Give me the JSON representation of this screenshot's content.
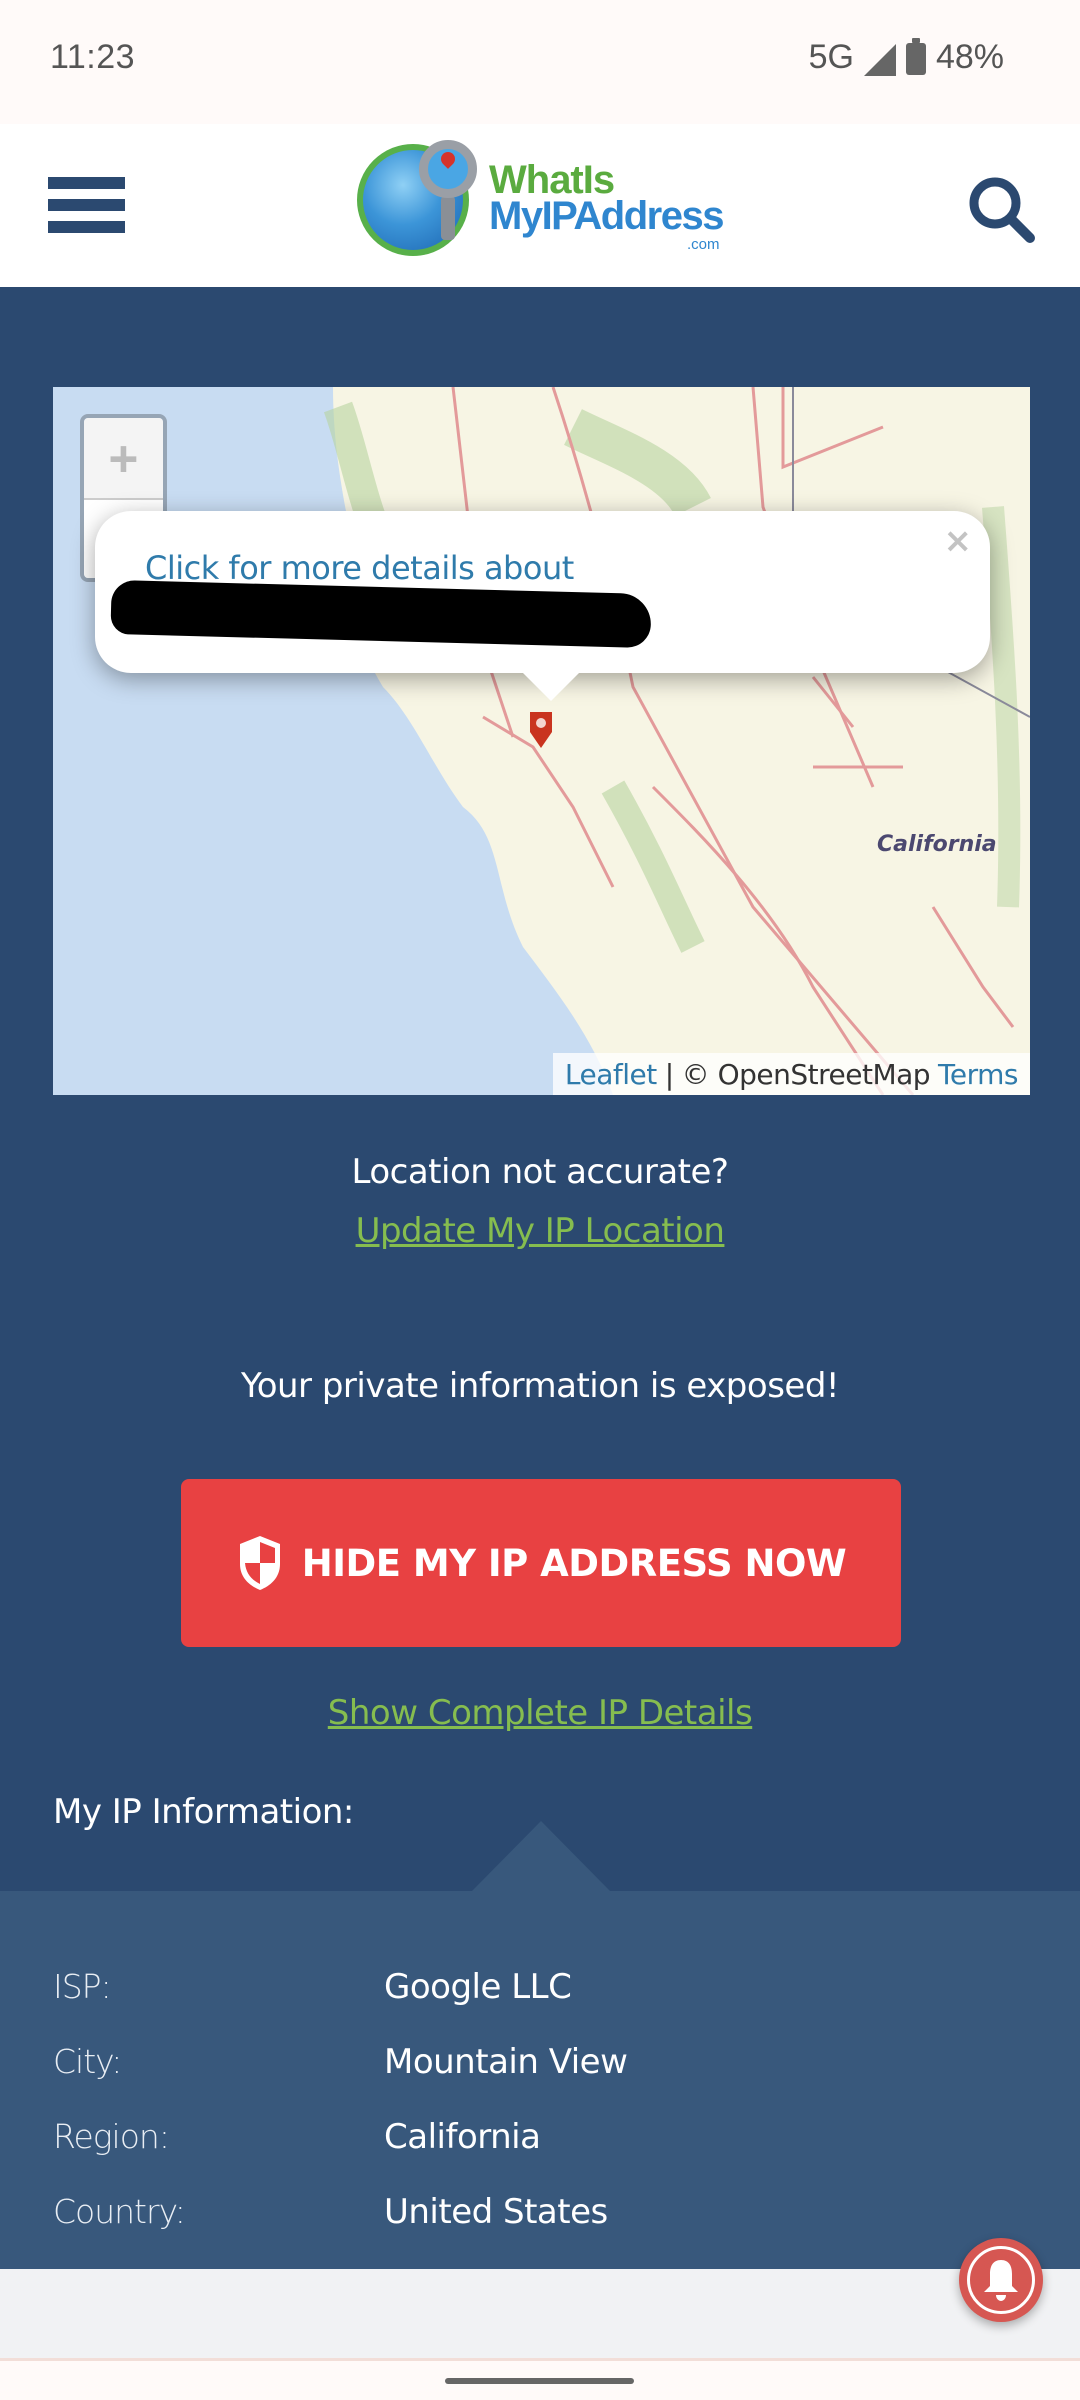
{
  "status_bar": {
    "time": "11:23",
    "network": "5G",
    "signal_icon": "cellular-signal-icon",
    "battery_icon": "battery-icon",
    "battery_percent": "48%"
  },
  "header": {
    "menu_icon": "hamburger-menu-icon",
    "logo": {
      "line1": "WhatIs",
      "line2": "MyIPAddress",
      "line3": ".com"
    },
    "search_icon": "search-icon"
  },
  "map": {
    "zoom_in_label": "+",
    "zoom_out_label": "−",
    "popup": {
      "link_text": "Click for more details about",
      "redacted": true,
      "close_label": "×"
    },
    "marker_icon": "map-marker-icon",
    "region_label": "California",
    "attribution": {
      "leaflet": "Leaflet",
      "separator": "|",
      "osm": "© OpenStreetMap",
      "terms": "Terms"
    }
  },
  "location": {
    "question": "Location not accurate?",
    "update_link": "Update My IP Location"
  },
  "warning": {
    "text": "Your private information is exposed!"
  },
  "cta": {
    "icon": "shield-icon",
    "label": "HIDE MY IP ADDRESS NOW",
    "color": "#e84142"
  },
  "details_link": "Show Complete IP Details",
  "ip_info": {
    "heading": "My IP Information:",
    "rows": [
      {
        "label": "ISP:",
        "value": "Google LLC"
      },
      {
        "label": "City:",
        "value": "Mountain View"
      },
      {
        "label": "Region:",
        "value": "California"
      },
      {
        "label": "Country:",
        "value": "United States"
      }
    ]
  },
  "notification_button": {
    "icon": "bell-icon"
  },
  "colors": {
    "primary_navy": "#2b4970",
    "panel_blue": "#38587c",
    "link_green": "#86bd4f",
    "cta_red": "#e84142"
  }
}
